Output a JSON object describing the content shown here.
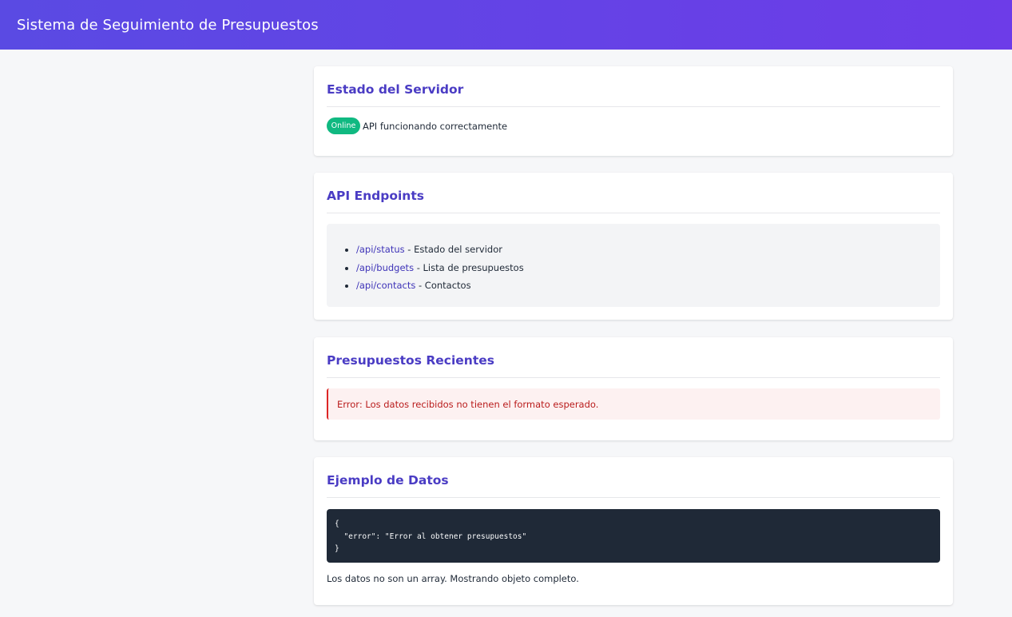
{
  "header": {
    "title": "Sistema de Seguimiento de Presupuestos"
  },
  "server_status": {
    "title": "Estado del Servidor",
    "badge": "Online",
    "message": "API funcionando correctamente"
  },
  "endpoints": {
    "title": "API Endpoints",
    "items": [
      {
        "path": "/api/status",
        "description": " - Estado del servidor"
      },
      {
        "path": "/api/budgets",
        "description": " - Lista de presupuestos"
      },
      {
        "path": "/api/contacts",
        "description": " - Contactos"
      }
    ]
  },
  "recent_budgets": {
    "title": "Presupuestos Recientes",
    "error": "Error: Los datos recibidos no tienen el formato esperado."
  },
  "data_example": {
    "title": "Ejemplo de Datos",
    "code": "{\n  \"error\": \"Error al obtener presupuestos\"\n}",
    "note": "Los datos no son un array. Mostrando objeto completo."
  },
  "colors": {
    "header_gradient_start": "#5a4ae3",
    "header_gradient_end": "#6d3ce8",
    "title": "#4a3cc4",
    "badge_online": "#10b981",
    "error_text": "#b91c1c",
    "code_bg": "#1f2937"
  }
}
